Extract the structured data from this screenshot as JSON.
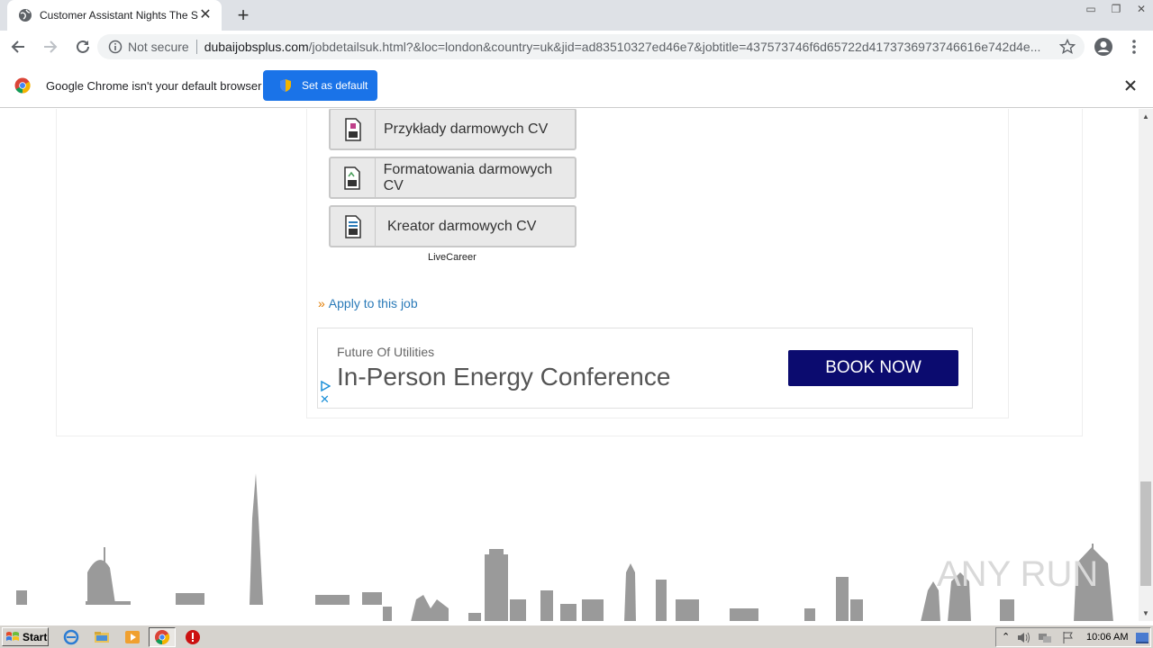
{
  "browser": {
    "tab_title": "Customer Assistant Nights The Strand",
    "url_security": "Not secure",
    "url_host": "dubaijobsplus.com",
    "url_path": "/jobdetailsuk.html?&loc=london&country=uk&jid=ad83510327ed46e7&jobtitle=437573746f6d65722d4173736973746616e742d4e...",
    "infobar_message": "Google Chrome isn't your default browser",
    "infobar_button": "Set as default"
  },
  "page": {
    "cv_buttons": [
      {
        "label": "Przykłady darmowych CV",
        "icon": "pdf-document-icon"
      },
      {
        "label": "Formatowania darmowych CV",
        "icon": "format-document-icon"
      },
      {
        "label": "Kreator darmowych CV",
        "icon": "builder-document-icon"
      }
    ],
    "cv_provider": "LiveCareer",
    "apply_arrows": "»",
    "apply_link": "Apply to this job",
    "ad": {
      "subtitle": "Future Of Utilities",
      "headline": "In-Person Energy Conference",
      "cta": "BOOK NOW"
    },
    "watermark": "ANY RUN"
  },
  "taskbar": {
    "start_label": "Start",
    "clock": "10:06 AM"
  },
  "colors": {
    "chrome_blue": "#1a73e8",
    "link_blue": "#2a7ab8",
    "ad_cta_bg": "#0b0b6f"
  }
}
